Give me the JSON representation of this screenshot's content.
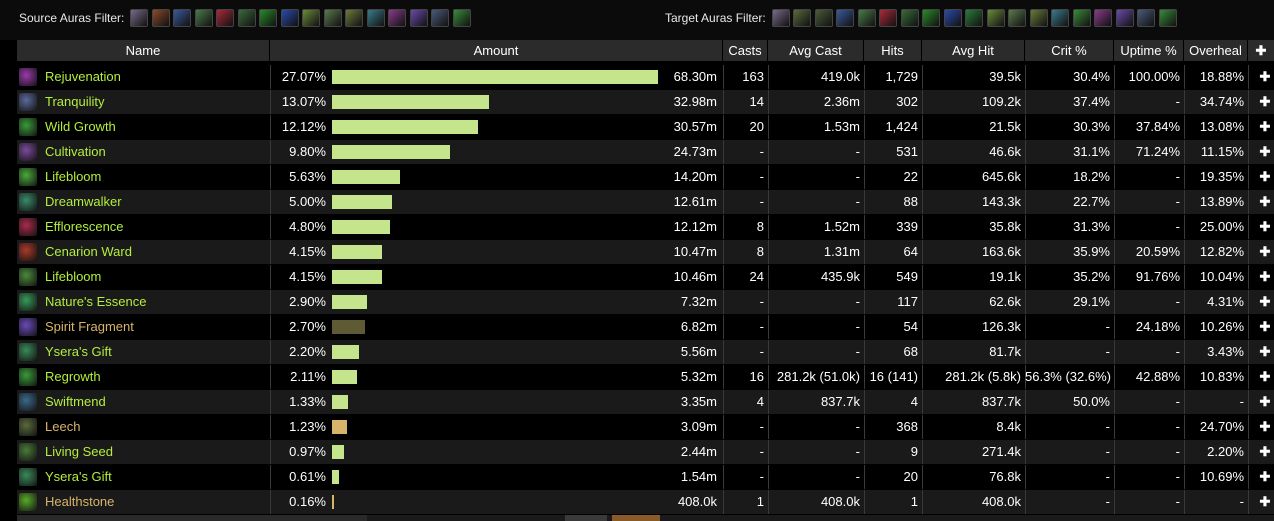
{
  "filters": {
    "source_label": "Source Auras Filter:",
    "target_label": "Target Auras Filter:",
    "source_icons": [
      {
        "icon": "lunar-aura-icon",
        "color": "#7a6a8a"
      },
      {
        "icon": "bear-aura-icon",
        "color": "#8a4a2a"
      },
      {
        "icon": "blue-orb-aura-icon",
        "color": "#3a5a9a"
      },
      {
        "icon": "green-pink-aura-icon",
        "color": "#4a7a4a"
      },
      {
        "icon": "red-flower-aura-icon",
        "color": "#aa2a3a"
      },
      {
        "icon": "leaf-aura-icon",
        "color": "#3a6a3a"
      },
      {
        "icon": "green-spirit-aura-icon",
        "color": "#2a8a2a"
      },
      {
        "icon": "lightning-aura-icon",
        "color": "#2a4aaa"
      },
      {
        "icon": "mushroom-aura-icon",
        "color": "#6a8a3a"
      },
      {
        "icon": "swirl-aura-icon",
        "color": "#5a7a4a"
      },
      {
        "icon": "sun-aura-icon",
        "color": "#6a7a3a"
      },
      {
        "icon": "crystal-aura-icon",
        "color": "#3a7a8a"
      },
      {
        "icon": "purple-flower-aura-icon",
        "color": "#8a3a8a"
      },
      {
        "icon": "violet-orb-aura-icon",
        "color": "#6a4aaa"
      },
      {
        "icon": "cloud-aura-icon",
        "color": "#4a5a7a"
      },
      {
        "icon": "wild-growth-aura-icon",
        "color": "#3a8a3a"
      }
    ],
    "target_icons": [
      {
        "icon": "lunar-aura-icon",
        "color": "#7a6a8a"
      },
      {
        "icon": "treant-aura-icon",
        "color": "#5a6a3a"
      },
      {
        "icon": "totem-aura-icon",
        "color": "#4a5a3a"
      },
      {
        "icon": "blue-orb-aura-icon",
        "color": "#3a5a9a"
      },
      {
        "icon": "green-pink-aura-icon",
        "color": "#4a7a4a"
      },
      {
        "icon": "red-flower-aura-icon",
        "color": "#aa2a3a"
      },
      {
        "icon": "leaf-aura-icon",
        "color": "#3a6a3a"
      },
      {
        "icon": "green-spirit-aura-icon",
        "color": "#2a8a2a"
      },
      {
        "icon": "lightning-aura-icon",
        "color": "#2a4aaa"
      },
      {
        "icon": "grass-aura-icon",
        "color": "#2a7a3a"
      },
      {
        "icon": "mushroom-aura-icon",
        "color": "#6a8a3a"
      },
      {
        "icon": "swirl-aura-icon",
        "color": "#5a7a4a"
      },
      {
        "icon": "sun-aura-icon",
        "color": "#6a7a3a"
      },
      {
        "icon": "crystal-aura-icon",
        "color": "#3a7a8a"
      },
      {
        "icon": "vine-aura-icon",
        "color": "#3a8a3a"
      },
      {
        "icon": "purple-flower-aura-icon",
        "color": "#8a3a8a"
      },
      {
        "icon": "violet-orb-aura-icon",
        "color": "#6a4aaa"
      },
      {
        "icon": "cloud-aura-icon",
        "color": "#4a5a7a"
      },
      {
        "icon": "wild-growth-aura-icon",
        "color": "#3a8a3a"
      }
    ]
  },
  "columns": [
    "Name",
    "Amount",
    "Casts",
    "Avg Cast",
    "Hits",
    "Avg Hit",
    "Crit %",
    "Uptime %",
    "Overheal"
  ],
  "header_plus": "✚",
  "rows": [
    {
      "name": "Rejuvenation",
      "icon": "rejuvenation-icon",
      "icon_color": "#9a3aaa",
      "name_color": "#b4f03c",
      "pct": "27.07%",
      "fill": 1.0,
      "bar_color": "#c5e58c",
      "amount": "68.30m",
      "casts": "163",
      "avg_cast": "419.0k",
      "hits": "1,729",
      "avg_hit": "39.5k",
      "crit": "30.4%",
      "uptime": "100.00%",
      "overheal": "18.88%"
    },
    {
      "name": "Tranquility",
      "icon": "tranquility-icon",
      "icon_color": "#5a6a9a",
      "name_color": "#b4f03c",
      "pct": "13.07%",
      "fill": 0.4829,
      "bar_color": "#c5e58c",
      "amount": "32.98m",
      "casts": "14",
      "avg_cast": "2.36m",
      "hits": "302",
      "avg_hit": "109.2k",
      "crit": "37.4%",
      "uptime": "-",
      "overheal": "34.74%"
    },
    {
      "name": "Wild Growth",
      "icon": "wild-growth-icon",
      "icon_color": "#3a9a3a",
      "name_color": "#b4f03c",
      "pct": "12.12%",
      "fill": 0.4476,
      "bar_color": "#c5e58c",
      "amount": "30.57m",
      "casts": "20",
      "avg_cast": "1.53m",
      "hits": "1,424",
      "avg_hit": "21.5k",
      "crit": "30.3%",
      "uptime": "37.84%",
      "overheal": "13.08%"
    },
    {
      "name": "Cultivation",
      "icon": "cultivation-icon",
      "icon_color": "#7a4a9a",
      "name_color": "#b4f03c",
      "pct": "9.80%",
      "fill": 0.3621,
      "bar_color": "#c5e58c",
      "amount": "24.73m",
      "casts": "-",
      "avg_cast": "-",
      "hits": "531",
      "avg_hit": "46.6k",
      "crit": "31.1%",
      "uptime": "71.24%",
      "overheal": "11.15%"
    },
    {
      "name": "Lifebloom",
      "icon": "lifebloom-icon",
      "icon_color": "#4aaa3a",
      "name_color": "#b4f03c",
      "pct": "5.63%",
      "fill": 0.2079,
      "bar_color": "#c5e58c",
      "amount": "14.20m",
      "casts": "-",
      "avg_cast": "-",
      "hits": "22",
      "avg_hit": "645.6k",
      "crit": "18.2%",
      "uptime": "-",
      "overheal": "19.35%"
    },
    {
      "name": "Dreamwalker",
      "icon": "dreamwalker-icon",
      "icon_color": "#3a8a6a",
      "name_color": "#b4f03c",
      "pct": "5.00%",
      "fill": 0.1846,
      "bar_color": "#c5e58c",
      "amount": "12.61m",
      "casts": "-",
      "avg_cast": "-",
      "hits": "88",
      "avg_hit": "143.3k",
      "crit": "22.7%",
      "uptime": "-",
      "overheal": "13.89%"
    },
    {
      "name": "Efflorescence",
      "icon": "efflorescence-icon",
      "icon_color": "#aa2a4a",
      "name_color": "#b4f03c",
      "pct": "4.80%",
      "fill": 0.1775,
      "bar_color": "#c5e58c",
      "amount": "12.12m",
      "casts": "8",
      "avg_cast": "1.52m",
      "hits": "339",
      "avg_hit": "35.8k",
      "crit": "31.3%",
      "uptime": "-",
      "overheal": "25.00%"
    },
    {
      "name": "Cenarion Ward",
      "icon": "cenarion-ward-icon",
      "icon_color": "#aa3a2a",
      "name_color": "#b4f03c",
      "pct": "4.15%",
      "fill": 0.1533,
      "bar_color": "#c5e58c",
      "amount": "10.47m",
      "casts": "8",
      "avg_cast": "1.31m",
      "hits": "64",
      "avg_hit": "163.6k",
      "crit": "35.9%",
      "uptime": "20.59%",
      "overheal": "12.82%"
    },
    {
      "name": "Lifebloom",
      "icon": "lifebloom-icon",
      "icon_color": "#4a8a3a",
      "name_color": "#b4f03c",
      "pct": "4.15%",
      "fill": 0.1532,
      "bar_color": "#c5e58c",
      "amount": "10.46m",
      "casts": "24",
      "avg_cast": "435.9k",
      "hits": "549",
      "avg_hit": "19.1k",
      "crit": "35.2%",
      "uptime": "91.76%",
      "overheal": "10.04%"
    },
    {
      "name": "Nature's Essence",
      "icon": "natures-essence-icon",
      "icon_color": "#3a9a5a",
      "name_color": "#b4f03c",
      "pct": "2.90%",
      "fill": 0.1072,
      "bar_color": "#c5e58c",
      "amount": "7.32m",
      "casts": "-",
      "avg_cast": "-",
      "hits": "117",
      "avg_hit": "62.6k",
      "crit": "29.1%",
      "uptime": "-",
      "overheal": "4.31%"
    },
    {
      "name": "Spirit Fragment",
      "icon": "spirit-fragment-icon",
      "icon_color": "#6a4aba",
      "name_color": "#d8b46a",
      "pct": "2.70%",
      "fill": 0.0999,
      "bar_color": "#5e5a34",
      "amount": "6.82m",
      "casts": "-",
      "avg_cast": "-",
      "hits": "54",
      "avg_hit": "126.3k",
      "crit": "-",
      "uptime": "24.18%",
      "overheal": "10.26%"
    },
    {
      "name": "Ysera's Gift",
      "icon": "yseras-gift-icon",
      "icon_color": "#3a8a5a",
      "name_color": "#b4f03c",
      "pct": "2.20%",
      "fill": 0.0814,
      "bar_color": "#c5e58c",
      "amount": "5.56m",
      "casts": "-",
      "avg_cast": "-",
      "hits": "68",
      "avg_hit": "81.7k",
      "crit": "-",
      "uptime": "-",
      "overheal": "3.43%"
    },
    {
      "name": "Regrowth",
      "icon": "regrowth-icon",
      "icon_color": "#3a9a3a",
      "name_color": "#b4f03c",
      "pct": "2.11%",
      "fill": 0.0779,
      "bar_color": "#c5e58c",
      "amount": "5.32m",
      "casts": "16",
      "avg_cast": "281.2k (51.0k)",
      "hits": "16 (141)",
      "avg_hit": "281.2k (5.8k)",
      "crit": "56.3% (32.6%)",
      "uptime": "42.88%",
      "overheal": "10.83%"
    },
    {
      "name": "Swiftmend",
      "icon": "swiftmend-icon",
      "icon_color": "#3a6a8a",
      "name_color": "#b4f03c",
      "pct": "1.33%",
      "fill": 0.049,
      "bar_color": "#c5e58c",
      "amount": "3.35m",
      "casts": "4",
      "avg_cast": "837.7k",
      "hits": "4",
      "avg_hit": "837.7k",
      "crit": "50.0%",
      "uptime": "-",
      "overheal": "-"
    },
    {
      "name": "Leech",
      "icon": "leech-icon",
      "icon_color": "#5a6a3a",
      "name_color": "#d8b46a",
      "pct": "1.23%",
      "fill": 0.0452,
      "bar_color": "#d8b46a",
      "amount": "3.09m",
      "casts": "-",
      "avg_cast": "-",
      "hits": "368",
      "avg_hit": "8.4k",
      "crit": "-",
      "uptime": "-",
      "overheal": "24.70%"
    },
    {
      "name": "Living Seed",
      "icon": "living-seed-icon",
      "icon_color": "#4a7a3a",
      "name_color": "#b4f03c",
      "pct": "0.97%",
      "fill": 0.0357,
      "bar_color": "#c5e58c",
      "amount": "2.44m",
      "casts": "-",
      "avg_cast": "-",
      "hits": "9",
      "avg_hit": "271.4k",
      "crit": "-",
      "uptime": "-",
      "overheal": "2.20%"
    },
    {
      "name": "Ysera's Gift",
      "icon": "yseras-gift-icon",
      "icon_color": "#3a8a5a",
      "name_color": "#b4f03c",
      "pct": "0.61%",
      "fill": 0.0225,
      "bar_color": "#c5e58c",
      "amount": "1.54m",
      "casts": "-",
      "avg_cast": "-",
      "hits": "20",
      "avg_hit": "76.8k",
      "crit": "-",
      "uptime": "-",
      "overheal": "10.69%"
    },
    {
      "name": "Healthstone",
      "icon": "healthstone-icon",
      "icon_color": "#5aaa2a",
      "name_color": "#d8b46a",
      "pct": "0.16%",
      "fill": 0.006,
      "bar_color": "#d8b46a",
      "amount": "408.0k",
      "casts": "1",
      "avg_cast": "408.0k",
      "hits": "1",
      "avg_hit": "408.0k",
      "crit": "-",
      "uptime": "-",
      "overheal": "-"
    }
  ],
  "colors": {
    "bar_track_dark": "#000",
    "header_bg": "#2b2b2b"
  }
}
